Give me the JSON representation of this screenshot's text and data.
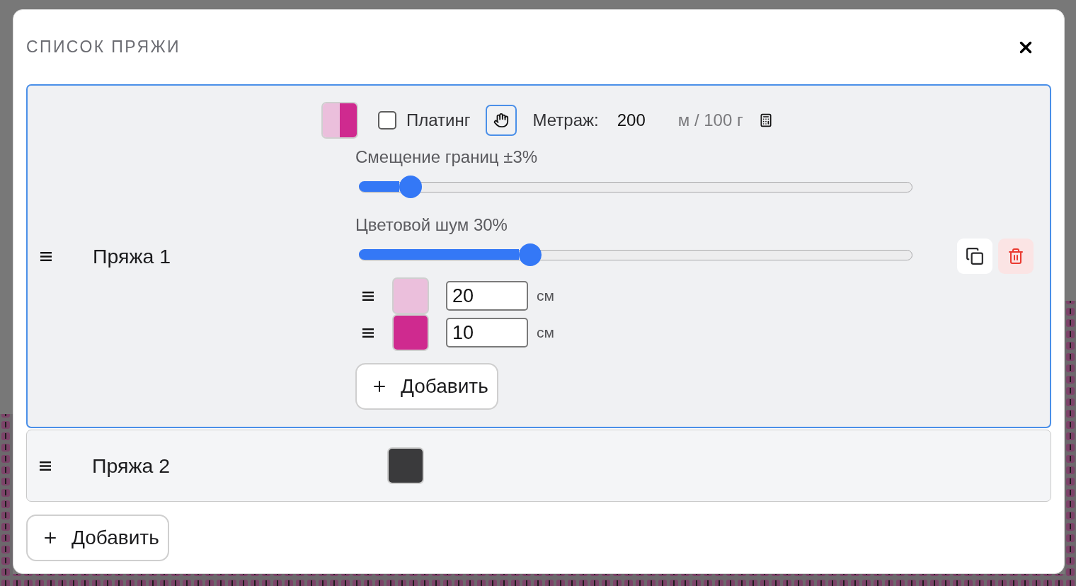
{
  "dialog": {
    "title": "СПИСОК ПРЯЖИ"
  },
  "yarns": [
    {
      "name": "Пряжа 1",
      "expanded": true,
      "plating": {
        "label": "Платинг",
        "checked": false
      },
      "yardage": {
        "label": "Метраж:",
        "value": "200",
        "unit": "м / 100 г"
      },
      "sliders": [
        {
          "label": "Смещение границ ±3%",
          "level": 0.075
        },
        {
          "label": "Цветовой шум 30%",
          "level": 0.3
        }
      ],
      "segments": [
        {
          "color": "#ebbfdc",
          "length": "20",
          "unit": "см"
        },
        {
          "color": "#cf2a8f",
          "length": "10",
          "unit": "см"
        }
      ],
      "add_segment_label": "Добавить"
    },
    {
      "name": "Пряжа 2",
      "expanded": false,
      "segments": [
        {
          "color": "#3a3a3c"
        }
      ]
    }
  ],
  "add_yarn_label": "Добавить"
}
